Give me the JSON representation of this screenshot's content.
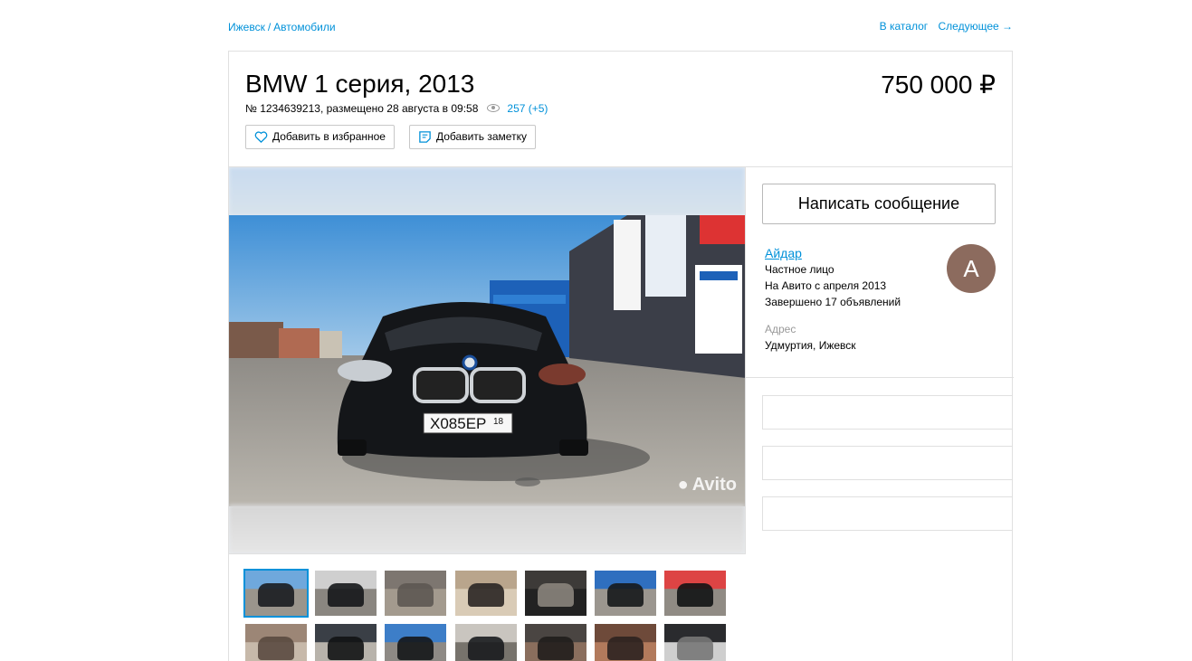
{
  "breadcrumb": {
    "city": "Ижевск",
    "separator": "/",
    "category": "Автомобили"
  },
  "nav": {
    "catalog": "В каталог",
    "next": "Следующее →"
  },
  "listing": {
    "title": "BMW 1 серия, 2013",
    "price": "750 000 ₽",
    "meta": "№ 1234639213, размещено 28 августа в 09:58",
    "views": "257 (+5)",
    "fav_button": "Добавить в избранное",
    "note_button": "Добавить заметку"
  },
  "gallery": {
    "watermark": "Avito",
    "plate": "Х085ЕР",
    "plate_region": "18",
    "thumbnails_count": 14,
    "selected_thumbnail": 0
  },
  "seller": {
    "message_button": "Написать сообщение",
    "name": "Айдар",
    "type": "Частное лицо",
    "since": "На Авито с апреля 2013",
    "completed": "Завершено 17 объявлений",
    "avatar_letter": "А",
    "address_label": "Адрес",
    "address": "Удмуртия, Ижевск"
  },
  "colors": {
    "link": "#0091d9",
    "avatar": "#8c6b5e",
    "border": "#e0e0e0"
  }
}
